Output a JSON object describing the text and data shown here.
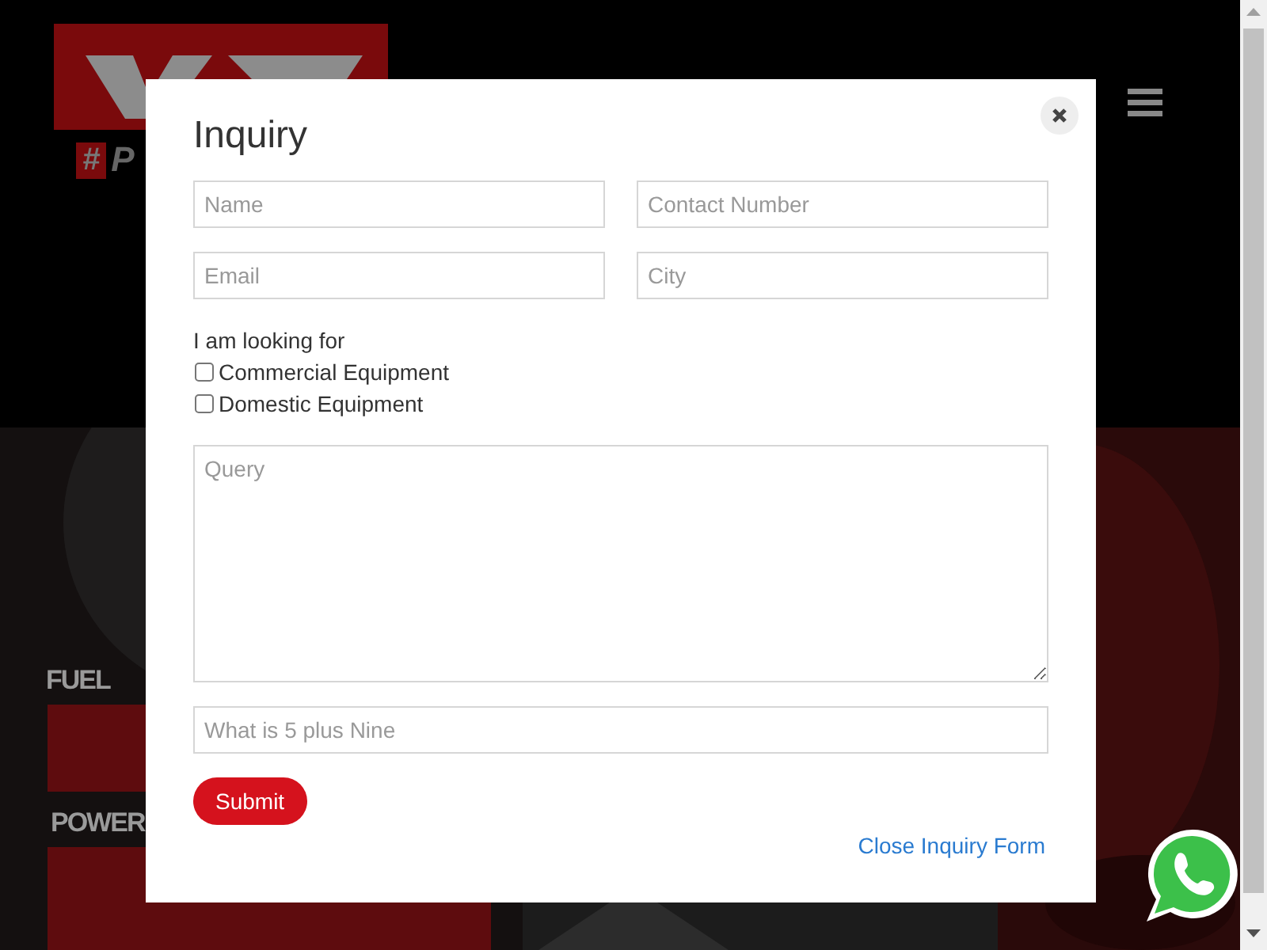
{
  "header": {
    "logo": {
      "tag_mark": "#",
      "tag_text": "P"
    }
  },
  "hero": {
    "small_lines": [
      "FUEL",
      "POWER"
    ]
  },
  "modal": {
    "title": "Inquiry",
    "fields": [
      {
        "placeholder": "Name"
      },
      {
        "placeholder": "Contact Number"
      },
      {
        "placeholder": "Email"
      },
      {
        "placeholder": "City"
      }
    ],
    "looking_for": {
      "label": "I am looking for",
      "options": [
        {
          "label": "Commercial Equipment",
          "checked": false
        },
        {
          "label": "Domestic Equipment",
          "checked": false
        }
      ]
    },
    "query": {
      "placeholder": "Query"
    },
    "captcha": {
      "placeholder": "What is 5 plus Nine"
    },
    "submit": "Submit",
    "close_link": "Close Inquiry Form"
  }
}
